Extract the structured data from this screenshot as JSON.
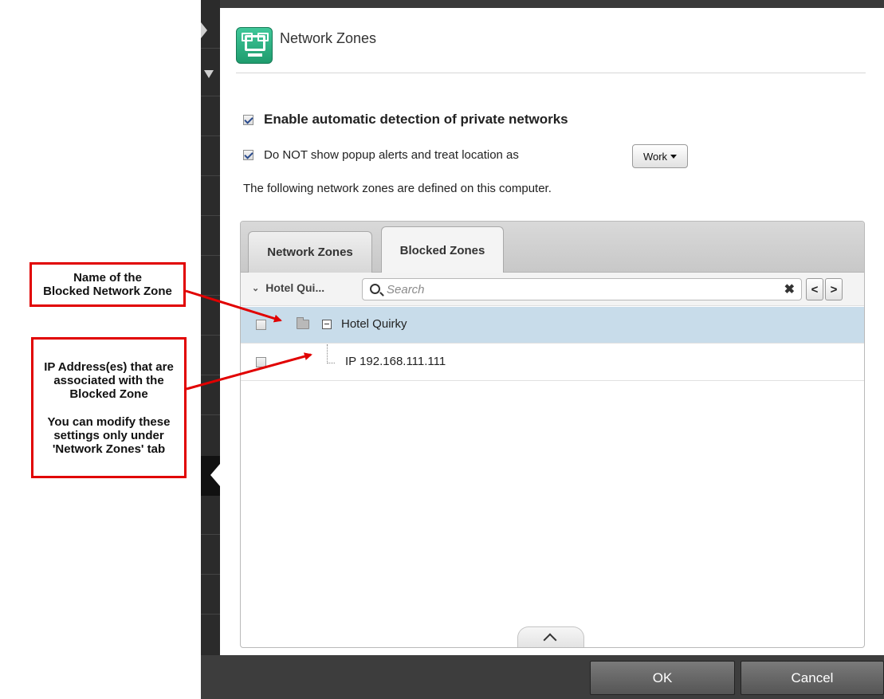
{
  "dialog": {
    "title": "Network Zones",
    "icon": "network-zones-icon"
  },
  "options": {
    "auto_detect": {
      "label": "Enable automatic detection of private networks",
      "checked": true
    },
    "no_popup": {
      "label": "Do NOT show popup alerts and treat location as",
      "checked": true
    },
    "location_select": {
      "value": "Work"
    },
    "description": "The following network zones are defined on this computer."
  },
  "tabs": [
    {
      "label": "Network Zones",
      "active": false
    },
    {
      "label": "Blocked Zones",
      "active": true
    }
  ],
  "toolbar": {
    "group_label": "Hotel Qui...",
    "search_placeholder": "Search",
    "clear_symbol": "✖",
    "prev_symbol": "<",
    "next_symbol": ">"
  },
  "rows": [
    {
      "label": "Hotel Quirky",
      "checked": false,
      "selected": true
    },
    {
      "label": "IP 192.168.111.111",
      "checked": false,
      "selected": false
    }
  ],
  "footer": {
    "ok_label": "OK",
    "cancel_label": "Cancel"
  },
  "annotations": {
    "zone_name_line1": "Name of the",
    "zone_name_line2": "Blocked Network Zone",
    "ip_line1": "IP Address(es) that are",
    "ip_line2": "associated with the",
    "ip_line3": "Blocked Zone",
    "ip_line4": "You can modify these",
    "ip_line5": "settings only under",
    "ip_line6": "'Network Zones' tab"
  },
  "colors": {
    "annotation_red": "#e10000",
    "selected_row": "#c8dcea",
    "footer_bg": "#3d3d3d"
  }
}
